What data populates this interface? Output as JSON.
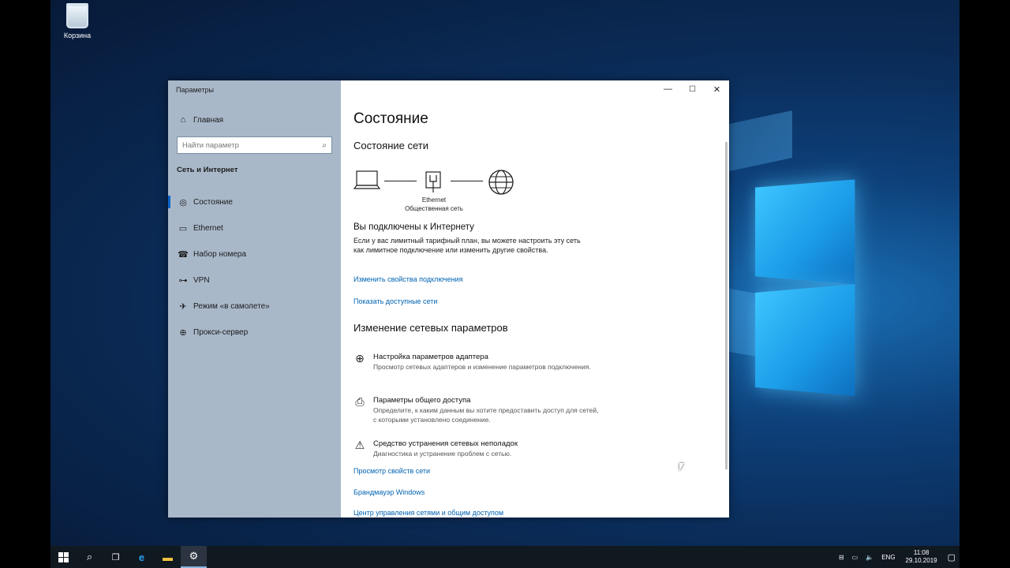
{
  "desktop": {
    "recycle_bin_label": "Корзина"
  },
  "window": {
    "title": "Параметры",
    "controls": {
      "minimize": "—",
      "maximize": "☐",
      "close": "✕"
    }
  },
  "sidebar": {
    "home_label": "Главная",
    "search_placeholder": "Найти параметр",
    "section_title": "Сеть и Интернет",
    "items": [
      {
        "label": "Состояние",
        "icon": "status-icon",
        "active": true
      },
      {
        "label": "Ethernet",
        "icon": "ethernet-icon",
        "active": false
      },
      {
        "label": "Набор номера",
        "icon": "dialup-icon",
        "active": false
      },
      {
        "label": "VPN",
        "icon": "vpn-icon",
        "active": false
      },
      {
        "label": "Режим «в самолете»",
        "icon": "airplane-icon",
        "active": false
      },
      {
        "label": "Прокси-сервер",
        "icon": "globe-icon",
        "active": false
      }
    ]
  },
  "main": {
    "title": "Состояние",
    "network_status_heading": "Состояние сети",
    "diagram": {
      "adapter_name": "Ethernet",
      "network_type": "Общественная сеть"
    },
    "connected_heading": "Вы подключены к Интернету",
    "connected_text": "Если у вас лимитный тарифный план, вы можете настроить эту сеть как лимитное подключение или изменить другие свойства.",
    "links_top": [
      "Изменить свойства подключения",
      "Показать доступные сети"
    ],
    "change_heading": "Изменение сетевых параметров",
    "settings_items": [
      {
        "title": "Настройка параметров адаптера",
        "desc": "Просмотр сетевых адаптеров и изменение параметров подключения.",
        "icon": "adapter-icon"
      },
      {
        "title": "Параметры общего доступа",
        "desc": "Определите, к каким данным вы хотите предоставить доступ для сетей, с которыми установлено соединение.",
        "icon": "sharing-icon"
      },
      {
        "title": "Средство устранения сетевых неполадок",
        "desc": "Диагностика и устранение проблем с сетью.",
        "icon": "warning-icon"
      }
    ],
    "links_bottom": [
      "Просмотр свойств сети",
      "Брандмауэр Windows",
      "Центр управления сетями и общим доступом"
    ]
  },
  "taskbar": {
    "language": "ENG",
    "time": "11:08",
    "date": "29.10.2019"
  },
  "colors": {
    "accent": "#0063b1",
    "sidebar_bg": "#a9b8c9",
    "taskbar_bg": "#101820"
  }
}
